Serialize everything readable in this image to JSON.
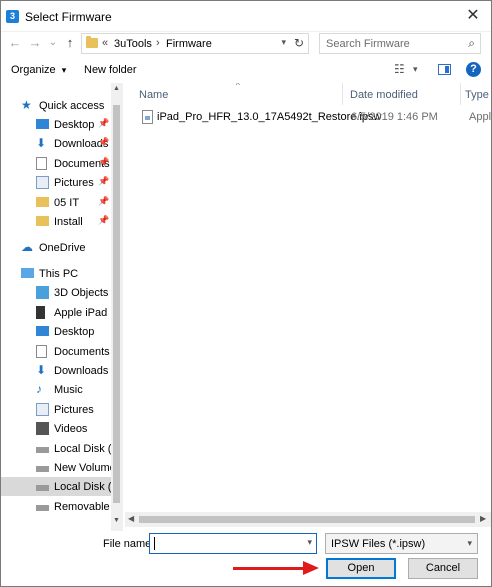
{
  "window": {
    "app_icon_label": "3",
    "title": "Select Firmware",
    "close_glyph": "✕"
  },
  "nav": {
    "back": "←",
    "forward": "→",
    "history": "⌄",
    "up": "↑",
    "breadcrumb": {
      "overflow": "«",
      "items": [
        "3uTools",
        "Firmware"
      ],
      "separator": "›"
    },
    "refresh": "↻",
    "search_placeholder": "Search Firmware"
  },
  "toolbar": {
    "organize": "Organize",
    "organize_caret": "▾",
    "new_folder": "New folder",
    "view_caret": "▾",
    "help": "?"
  },
  "sidebar": {
    "items": [
      {
        "label": "Quick access",
        "icon": "star-icon",
        "pinned": false
      },
      {
        "label": "Desktop",
        "icon": "desktop-icon",
        "pinned": true
      },
      {
        "label": "Downloads",
        "icon": "download-icon",
        "pinned": true
      },
      {
        "label": "Documents",
        "icon": "documents-icon",
        "pinned": true
      },
      {
        "label": "Pictures",
        "icon": "pictures-icon",
        "pinned": true
      },
      {
        "label": "05 IT",
        "icon": "folder-icon",
        "pinned": true
      },
      {
        "label": "Install",
        "icon": "folder-icon",
        "pinned": true
      },
      {
        "label": "OneDrive",
        "icon": "cloud-icon",
        "pinned": false
      },
      {
        "label": "This PC",
        "icon": "computer-icon",
        "pinned": false
      },
      {
        "label": "3D Objects",
        "icon": "cube-icon",
        "pinned": false
      },
      {
        "label": "Apple iPad",
        "icon": "tablet-icon",
        "pinned": false
      },
      {
        "label": "Desktop",
        "icon": "desktop-icon",
        "pinned": false
      },
      {
        "label": "Documents",
        "icon": "documents-icon",
        "pinned": false
      },
      {
        "label": "Downloads",
        "icon": "download-icon",
        "pinned": false
      },
      {
        "label": "Music",
        "icon": "music-icon",
        "pinned": false
      },
      {
        "label": "Pictures",
        "icon": "pictures-icon",
        "pinned": false
      },
      {
        "label": "Videos",
        "icon": "videos-icon",
        "pinned": false
      },
      {
        "label": "Local Disk (C:)",
        "icon": "windows-drive-icon",
        "pinned": false
      },
      {
        "label": "New Volume (D:",
        "icon": "drive-icon",
        "pinned": false
      },
      {
        "label": "Local Disk (E:)",
        "icon": "drive-icon",
        "pinned": false,
        "selected": true
      },
      {
        "label": "Removable Disk",
        "icon": "usb-drive-icon",
        "pinned": false
      }
    ],
    "pin_glyph": "📌"
  },
  "filelist": {
    "columns": [
      "Name",
      "Date modified",
      "Type"
    ],
    "sort_glyph": "^",
    "files": [
      {
        "name": "iPad_Pro_HFR_13.0_17A5492t_Restore.ipsw",
        "date": "6/5/2019 1:46 PM",
        "type": "Apple"
      }
    ]
  },
  "bottom": {
    "file_name_label": "File name:",
    "file_name_value": "",
    "filter": "IPSW Files (*.ipsw)",
    "open": "Open",
    "cancel": "Cancel"
  },
  "colors": {
    "accent": "#0078d7",
    "annotation_arrow": "#e01b1b",
    "selection": "#d9d9d9"
  }
}
